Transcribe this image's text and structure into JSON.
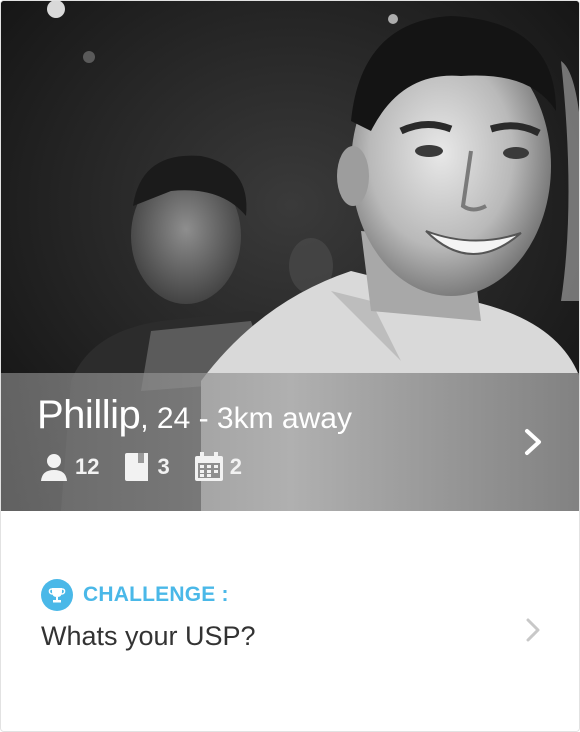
{
  "profile": {
    "name": "Phillip",
    "details": ", 24 - 3km away",
    "stats": [
      {
        "icon": "person-icon",
        "value": "12"
      },
      {
        "icon": "book-icon",
        "value": "3"
      },
      {
        "icon": "calendar-icon",
        "value": "2"
      }
    ]
  },
  "challenge": {
    "icon": "trophy-icon",
    "label": "CHALLENGE :",
    "question": "Whats your USP?"
  },
  "colors": {
    "accent": "#4ab8e8",
    "overlay": "#8a8a8a",
    "text_dark": "#333333"
  }
}
